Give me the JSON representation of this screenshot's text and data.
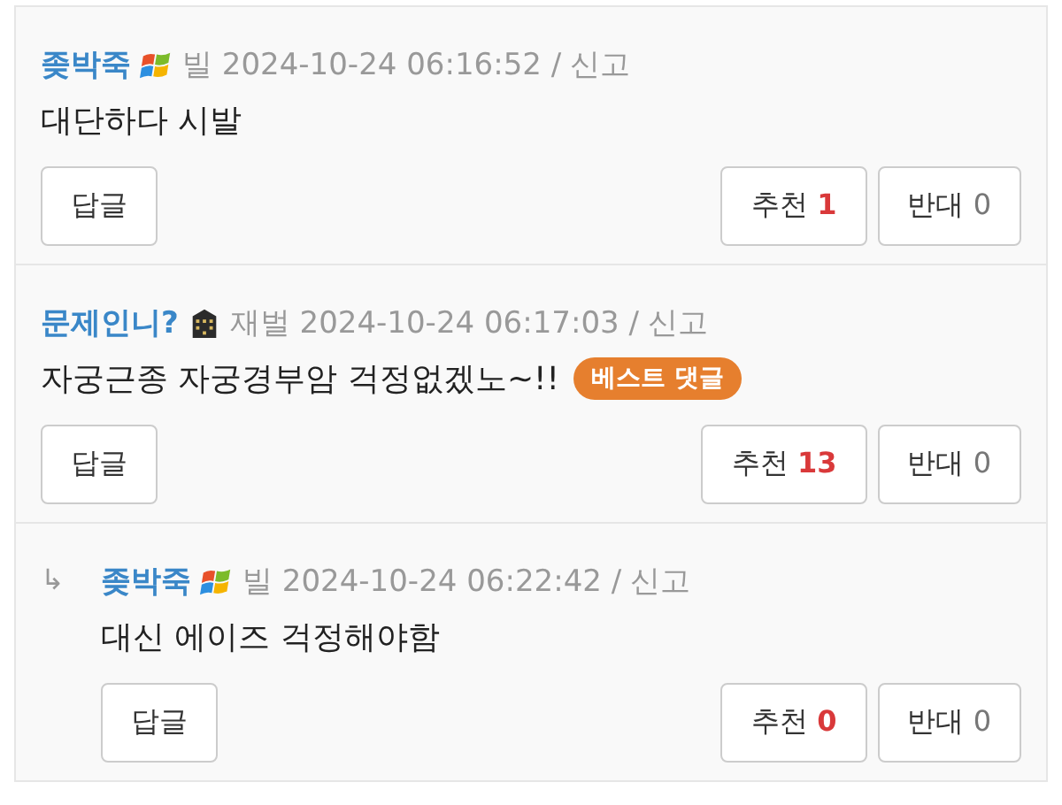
{
  "comments": [
    {
      "author": "좆박죽",
      "rank": {
        "label": "빌",
        "kind": "flag"
      },
      "time": "2024-10-24 06:16:52",
      "separator": "/",
      "report": "신고",
      "body": "대단하다 시발",
      "reply_button": "답글",
      "up": {
        "label": "추천",
        "count": "1"
      },
      "down": {
        "label": "반대",
        "count": "0"
      }
    },
    {
      "author": "문제인니?",
      "rank": {
        "label": "재벌",
        "kind": "building"
      },
      "time": "2024-10-24 06:17:03",
      "separator": "/",
      "report": "신고",
      "body": "자궁근종 자궁경부암 걱정없겠노~!!",
      "best_badge": "베스트 댓글",
      "reply_button": "답글",
      "up": {
        "label": "추천",
        "count": "13"
      },
      "down": {
        "label": "반대",
        "count": "0"
      }
    },
    {
      "reply_mark": "↳",
      "author": "좆박죽",
      "rank": {
        "label": "빌",
        "kind": "flag"
      },
      "time": "2024-10-24 06:22:42",
      "separator": "/",
      "report": "신고",
      "body": "대신 에이즈 걱정해야함",
      "reply_button": "답글",
      "up": {
        "label": "추천",
        "count": "0"
      },
      "down": {
        "label": "반대",
        "count": "0"
      }
    }
  ]
}
